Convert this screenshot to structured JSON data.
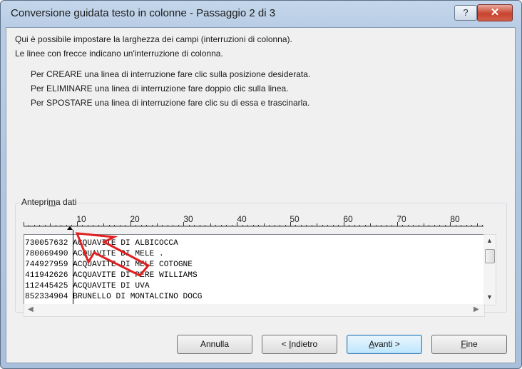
{
  "window": {
    "title": "Conversione guidata testo in colonne - Passaggio 2 di 3",
    "help_glyph": "?",
    "close_glyph": "✕"
  },
  "intro": {
    "line1": "Qui è possibile impostare la larghezza dei campi (interruzioni di colonna).",
    "line2": "Le linee con frecce indicano un'interruzione di colonna."
  },
  "instructions": {
    "create": "Per CREARE una linea di interruzione fare clic sulla posizione desiderata.",
    "delete": "Per ELIMINARE una linea di interruzione fare doppio clic sulla linea.",
    "move": "Per SPOSTARE una linea di interruzione fare clic su di essa e trascinarla."
  },
  "preview": {
    "label": "Anteprima dati",
    "ruler": [
      "10",
      "20",
      "30",
      "40",
      "50",
      "60",
      "70",
      "80"
    ],
    "rows": [
      "730057632 ACQUAVITE DI ALBICOCCA",
      "780069490 ACQUAVITE DI MELE .",
      "744927959 ACQUAVITE DI MELE COTOGNE",
      "411942626 ACQUAVITE DI PERE WILLIAMS",
      "112445425 ACQUAVITE DI UVA",
      "852334904 BRUNELLO DI MONTALCINO DOCG"
    ]
  },
  "buttons": {
    "cancel": "Annulla",
    "back_prefix": "< ",
    "back_key": "I",
    "back_rest": "ndietro",
    "next_key": "A",
    "next_rest": "vanti >",
    "finish_key": "F",
    "finish_rest": "ine"
  },
  "colors": {
    "annotation_arrow": "#e02020",
    "title_bar": "#b8cde5",
    "close_button": "#c7432d"
  }
}
